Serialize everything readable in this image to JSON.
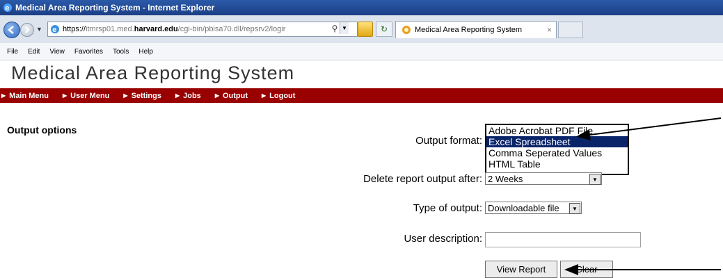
{
  "browser": {
    "window_title": "Medical Area Reporting System - Internet Explorer",
    "url_prefix": "https://",
    "url_host_grey": "itmrsp01.med.",
    "url_host_bold": "harvard.edu",
    "url_path": "/cgi-bin/pbisa70.dll/repsrv2/logir",
    "tab_title": "Medical Area Reporting System",
    "tab_close": "×",
    "menu": [
      "File",
      "Edit",
      "View",
      "Favorites",
      "Tools",
      "Help"
    ]
  },
  "app": {
    "title": "Medical Area Reporting System",
    "nav": [
      "Main Menu",
      "User Menu",
      "Settings",
      "Jobs",
      "Output",
      "Logout"
    ]
  },
  "form": {
    "section_title": "Output options",
    "output_format_label": "Output format:",
    "output_format_options": [
      "Adobe Acrobat PDF File",
      "Excel Spreadsheet",
      "Comma Seperated Values",
      "HTML Table"
    ],
    "output_format_selected": "Excel Spreadsheet",
    "delete_after_label": "Delete report output after:",
    "delete_after_value": "2 Weeks",
    "type_label": "Type of output:",
    "type_value": "Downloadable file",
    "description_label": "User description:",
    "description_value": "",
    "view_report_button": "View Report",
    "clear_button": "Clear"
  },
  "colors": {
    "nav_bar": "#990000",
    "selected_option": "#0a246a"
  }
}
